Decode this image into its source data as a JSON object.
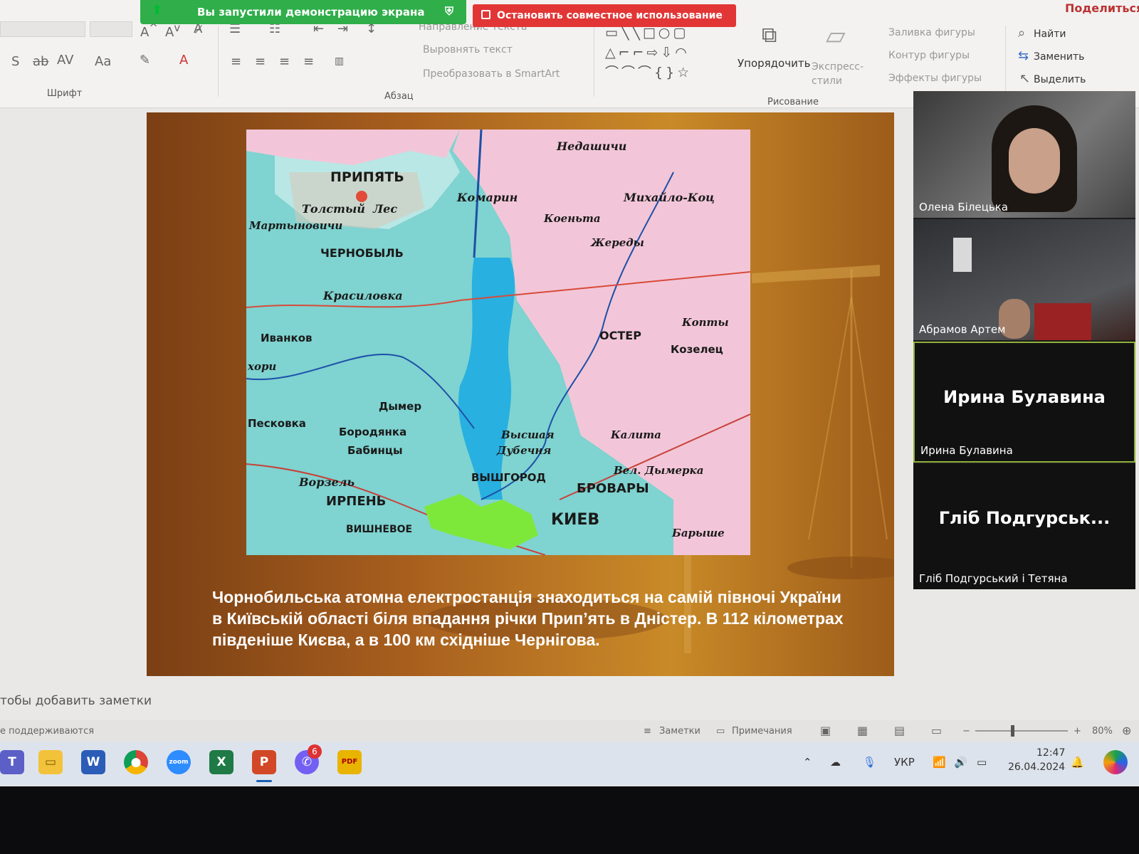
{
  "ribbon": {
    "groups": {
      "font": "Шрифт",
      "paragraph": "Абзац",
      "drawing": "Рисование"
    },
    "paragraph_tools": {
      "text_direction": "Направление текста",
      "align_text": "Выровнять текст",
      "smartart": "Преобразовать в SmartArt"
    },
    "drawing_tools": {
      "arrange": "Упорядочить",
      "quick_styles": "Экспресс-стили",
      "fill": "Заливка фигуры",
      "outline": "Контур фигуры",
      "effects": "Эффекты фигуры"
    },
    "editing": {
      "find": "Найти",
      "replace": "Заменить",
      "select": "Выделить"
    },
    "share": "Поделиться"
  },
  "share_banner": {
    "status": "Вы запустили демонстрацию экрана",
    "stop": "Остановить совместное использование"
  },
  "slide": {
    "caption": "Чорнобильська атомна електростанція знаходиться на самій півночі України в Київській області біля впадання річки Прип’ять в Дністер. В 112 кілометрах південіше Києва, а в 100 км східніше Чернігова.",
    "map_labels": {
      "pripyat": "ПРИПЯТЬ",
      "nedanchichi": "Недашичи",
      "tolsty_les": "Толстый  Лес",
      "martynovichi": "Мартыновичи",
      "komarin": "Комарин",
      "mikhailo": "Михайло-Коц",
      "koptsy": "Коеньта",
      "chernobyl": "ЧЕРНОБЫЛЬ",
      "zhereds": "Жереды",
      "krasilovka": "Красиловка",
      "ivankov": "Иванков",
      "oster": "ОСТЕР",
      "koptsy2": "Копты",
      "kozelets": "Козелец",
      "khori": "хори",
      "dymer": "Дымер",
      "peskovka": "Песковка",
      "borodyanka": "Бородянка",
      "babintsy": "Бабинцы",
      "vysshaya": "Высшая",
      "dubechnya": "Дубечня",
      "kalita": "Калита",
      "vorzel": "Ворзель",
      "irpen": "ИРПЕНЬ",
      "vyshgorod": "ВЫШГОРОД",
      "vel_dymerka": "Вел. Дымерка",
      "brovary": "БРОВАРЫ",
      "vishnevoe": "ВИШНЕВОЕ",
      "kiev": "КИЕВ",
      "baryshevka": "Барыше"
    }
  },
  "participants": [
    {
      "name": "Олена Білецька"
    },
    {
      "name": "Абрамов Артем"
    },
    {
      "big": "Ирина Булавина",
      "name": "Ирина Булавина"
    },
    {
      "big": "Гліб Подгурськ...",
      "name": "Гліб Подгурський і Тетяна"
    }
  ],
  "notes_placeholder": "тобы добавить заметки",
  "status": {
    "unsupported": "е поддерживаются",
    "notes_btn": "Заметки",
    "comments_btn": "Примечания",
    "zoom": "80%"
  },
  "taskbar": {
    "lang": "УКР",
    "time": "12:47",
    "date": "26.04.2024",
    "viber_badge": "6",
    "pdf_label": "PDF",
    "zoom_label": "zoom"
  }
}
